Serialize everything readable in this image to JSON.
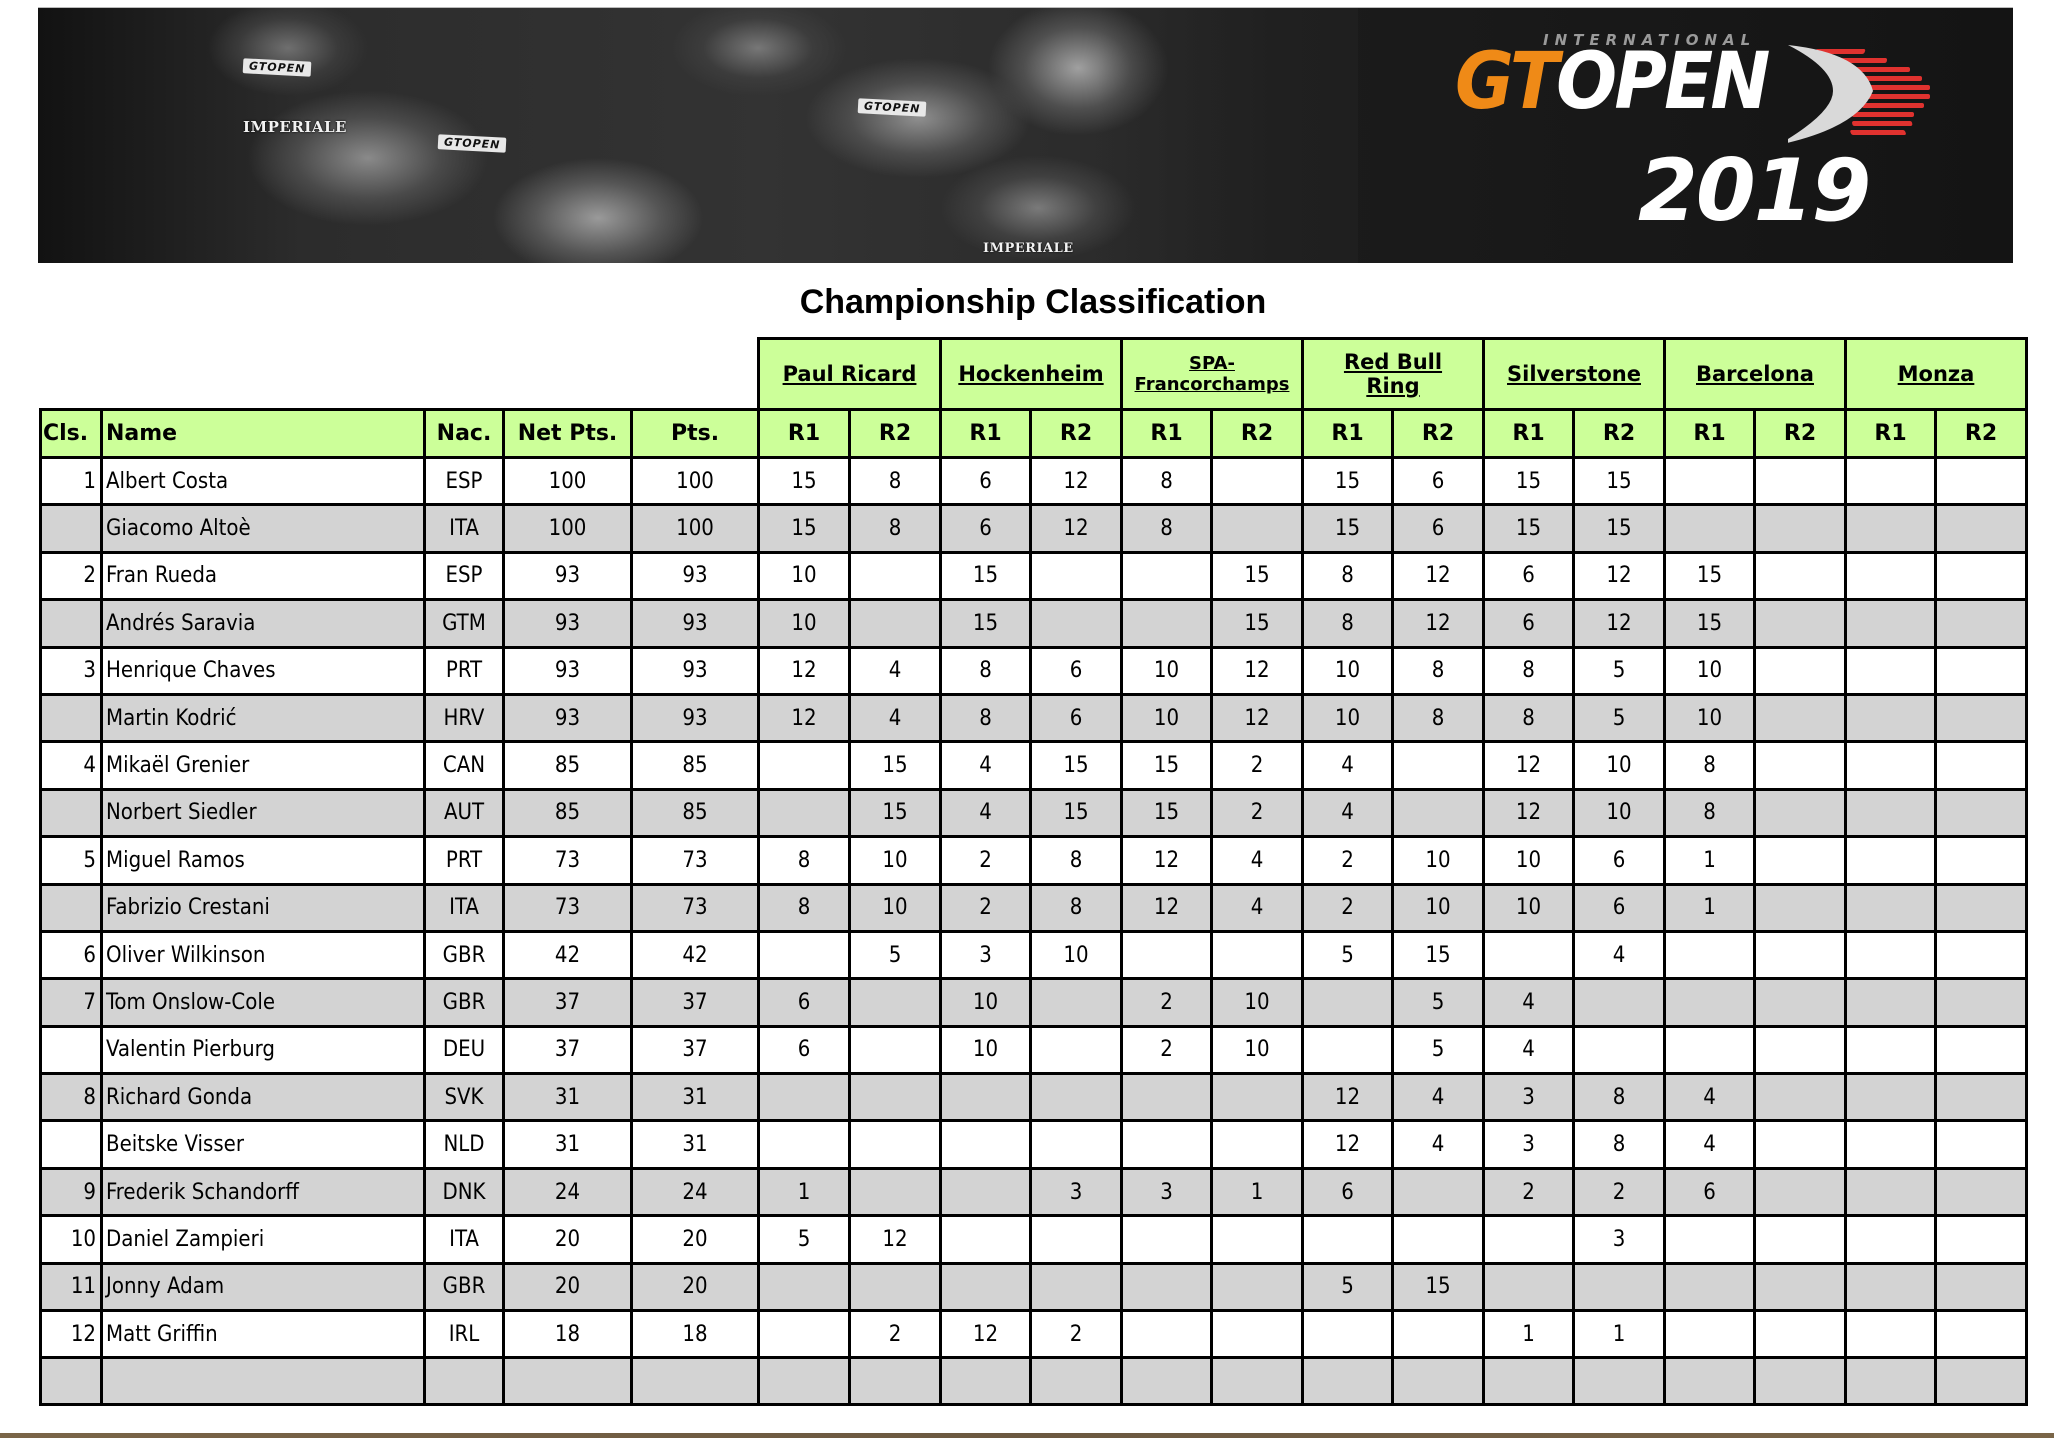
{
  "banner": {
    "logo_international": "INTERNATIONAL",
    "logo_gt": "GT",
    "logo_open": "OPEN",
    "logo_year": "2019",
    "photo_tags": [
      "IMPERIALE",
      "GTOPEN",
      "GTOPEN",
      "GTOPEN",
      "IMPERIALE"
    ]
  },
  "title": "Championship Classification",
  "colors": {
    "header_green": "#ccff99",
    "row_gray": "#d3d3d3",
    "logo_orange": "#ef8a17",
    "logo_red": "#e0322f"
  },
  "table": {
    "columns": {
      "cls": "Cls.",
      "name": "Name",
      "nac": "Nac.",
      "net_pts": "Net Pts.",
      "pts": "Pts."
    },
    "events": [
      {
        "name": "Paul Ricard",
        "races": [
          "R1",
          "R2"
        ]
      },
      {
        "name": "Hockenheim",
        "races": [
          "R1",
          "R2"
        ]
      },
      {
        "name": "SPA-Francorchamps",
        "races": [
          "R1",
          "R2"
        ]
      },
      {
        "name": "Red Bull Ring",
        "races": [
          "R1",
          "R2"
        ]
      },
      {
        "name": "Silverstone",
        "races": [
          "R1",
          "R2"
        ]
      },
      {
        "name": "Barcelona",
        "races": [
          "R1",
          "R2"
        ]
      },
      {
        "name": "Monza",
        "races": [
          "R1",
          "R2"
        ]
      }
    ],
    "rows": [
      {
        "cls": "1",
        "name": "Albert Costa",
        "nac": "ESP",
        "net": "100",
        "pts": "100",
        "shade": "white",
        "results": [
          "15",
          "8",
          "6",
          "12",
          "8",
          "",
          "15",
          "6",
          "15",
          "15",
          "",
          "",
          "",
          ""
        ]
      },
      {
        "cls": "",
        "name": "Giacomo Altoè",
        "nac": "ITA",
        "net": "100",
        "pts": "100",
        "shade": "gray",
        "results": [
          "15",
          "8",
          "6",
          "12",
          "8",
          "",
          "15",
          "6",
          "15",
          "15",
          "",
          "",
          "",
          ""
        ]
      },
      {
        "cls": "2",
        "name": "Fran Rueda",
        "nac": "ESP",
        "net": "93",
        "pts": "93",
        "shade": "white",
        "results": [
          "10",
          "",
          "15",
          "",
          "",
          "15",
          "8",
          "12",
          "6",
          "12",
          "15",
          "",
          "",
          ""
        ]
      },
      {
        "cls": "",
        "name": "Andrés Saravia",
        "nac": "GTM",
        "net": "93",
        "pts": "93",
        "shade": "gray",
        "results": [
          "10",
          "",
          "15",
          "",
          "",
          "15",
          "8",
          "12",
          "6",
          "12",
          "15",
          "",
          "",
          ""
        ]
      },
      {
        "cls": "3",
        "name": "Henrique Chaves",
        "nac": "PRT",
        "net": "93",
        "pts": "93",
        "shade": "white",
        "results": [
          "12",
          "4",
          "8",
          "6",
          "10",
          "12",
          "10",
          "8",
          "8",
          "5",
          "10",
          "",
          "",
          ""
        ]
      },
      {
        "cls": "",
        "name": "Martin Kodrić",
        "nac": "HRV",
        "net": "93",
        "pts": "93",
        "shade": "gray",
        "results": [
          "12",
          "4",
          "8",
          "6",
          "10",
          "12",
          "10",
          "8",
          "8",
          "5",
          "10",
          "",
          "",
          ""
        ]
      },
      {
        "cls": "4",
        "name": "Mikaël Grenier",
        "nac": "CAN",
        "net": "85",
        "pts": "85",
        "shade": "white",
        "results": [
          "",
          "15",
          "4",
          "15",
          "15",
          "2",
          "4",
          "",
          "12",
          "10",
          "8",
          "",
          "",
          ""
        ]
      },
      {
        "cls": "",
        "name": "Norbert Siedler",
        "nac": "AUT",
        "net": "85",
        "pts": "85",
        "shade": "gray",
        "results": [
          "",
          "15",
          "4",
          "15",
          "15",
          "2",
          "4",
          "",
          "12",
          "10",
          "8",
          "",
          "",
          ""
        ]
      },
      {
        "cls": "5",
        "name": "Miguel Ramos",
        "nac": "PRT",
        "net": "73",
        "pts": "73",
        "shade": "white",
        "results": [
          "8",
          "10",
          "2",
          "8",
          "12",
          "4",
          "2",
          "10",
          "10",
          "6",
          "1",
          "",
          "",
          ""
        ]
      },
      {
        "cls": "",
        "name": "Fabrizio Crestani",
        "nac": "ITA",
        "net": "73",
        "pts": "73",
        "shade": "gray",
        "results": [
          "8",
          "10",
          "2",
          "8",
          "12",
          "4",
          "2",
          "10",
          "10",
          "6",
          "1",
          "",
          "",
          ""
        ]
      },
      {
        "cls": "6",
        "name": "Oliver Wilkinson",
        "nac": "GBR",
        "net": "42",
        "pts": "42",
        "shade": "white",
        "results": [
          "",
          "5",
          "3",
          "10",
          "",
          "",
          "5",
          "15",
          "",
          "4",
          "",
          "",
          "",
          ""
        ]
      },
      {
        "cls": "7",
        "name": "Tom Onslow-Cole",
        "nac": "GBR",
        "net": "37",
        "pts": "37",
        "shade": "gray",
        "results": [
          "6",
          "",
          "10",
          "",
          "2",
          "10",
          "",
          "5",
          "4",
          "",
          "",
          "",
          "",
          ""
        ]
      },
      {
        "cls": "",
        "name": "Valentin Pierburg",
        "nac": "DEU",
        "net": "37",
        "pts": "37",
        "shade": "white",
        "results": [
          "6",
          "",
          "10",
          "",
          "2",
          "10",
          "",
          "5",
          "4",
          "",
          "",
          "",
          "",
          ""
        ]
      },
      {
        "cls": "8",
        "name": "Richard Gonda",
        "nac": "SVK",
        "net": "31",
        "pts": "31",
        "shade": "gray",
        "results": [
          "",
          "",
          "",
          "",
          "",
          "",
          "12",
          "4",
          "3",
          "8",
          "4",
          "",
          "",
          ""
        ]
      },
      {
        "cls": "",
        "name": "Beitske Visser",
        "nac": "NLD",
        "net": "31",
        "pts": "31",
        "shade": "white",
        "results": [
          "",
          "",
          "",
          "",
          "",
          "",
          "12",
          "4",
          "3",
          "8",
          "4",
          "",
          "",
          ""
        ]
      },
      {
        "cls": "9",
        "name": "Frederik Schandorff",
        "nac": "DNK",
        "net": "24",
        "pts": "24",
        "shade": "gray",
        "results": [
          "1",
          "",
          "",
          "3",
          "3",
          "1",
          "6",
          "",
          "2",
          "2",
          "6",
          "",
          "",
          ""
        ]
      },
      {
        "cls": "10",
        "name": "Daniel Zampieri",
        "nac": "ITA",
        "net": "20",
        "pts": "20",
        "shade": "white",
        "results": [
          "5",
          "12",
          "",
          "",
          "",
          "",
          "",
          "",
          "",
          "3",
          "",
          "",
          "",
          ""
        ]
      },
      {
        "cls": "11",
        "name": "Jonny Adam",
        "nac": "GBR",
        "net": "20",
        "pts": "20",
        "shade": "gray",
        "results": [
          "",
          "",
          "",
          "",
          "",
          "",
          "5",
          "15",
          "",
          "",
          "",
          "",
          "",
          ""
        ]
      },
      {
        "cls": "12",
        "name": "Matt Griffin",
        "nac": "IRL",
        "net": "18",
        "pts": "18",
        "shade": "white",
        "results": [
          "",
          "2",
          "12",
          "2",
          "",
          "",
          "",
          "",
          "1",
          "1",
          "",
          "",
          "",
          ""
        ]
      }
    ]
  }
}
